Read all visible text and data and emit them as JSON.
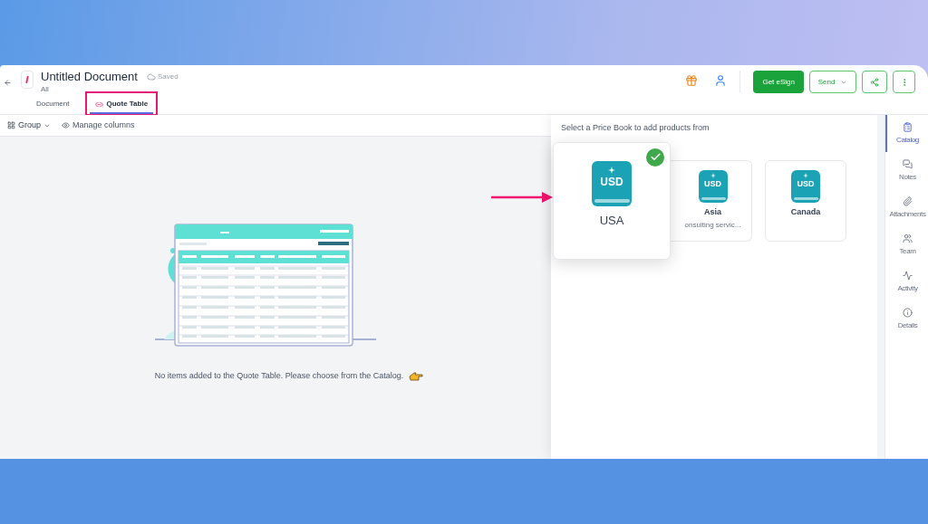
{
  "header": {
    "title": "Untitled Document",
    "save_status": "Saved",
    "subtitle": "All"
  },
  "tabs": [
    {
      "label": "Document",
      "selected": false
    },
    {
      "label": "Quote Table",
      "selected": true
    }
  ],
  "actions": {
    "primary": "Get eSign",
    "send": "Send"
  },
  "toolbar": {
    "group": "Group",
    "manage": "Manage columns"
  },
  "empty_message": "No items added to the Quote Table. Please choose from the Catalog.",
  "catalog": {
    "heading": "Select a Price Book to add products from",
    "price_books": [
      {
        "currency": "USD",
        "name": "USA",
        "selected": true
      },
      {
        "currency": "USD",
        "name": "Asia",
        "description": "onsulting servic...",
        "selected": false
      },
      {
        "currency": "USD",
        "name": "Canada",
        "selected": false
      }
    ]
  },
  "sidebar": [
    {
      "label": "Catalog",
      "selected": true
    },
    {
      "label": "Notes",
      "selected": false
    },
    {
      "label": "Attachments",
      "selected": false
    },
    {
      "label": "Team",
      "selected": false
    },
    {
      "label": "Activity",
      "selected": false
    },
    {
      "label": "Details",
      "selected": false
    }
  ]
}
